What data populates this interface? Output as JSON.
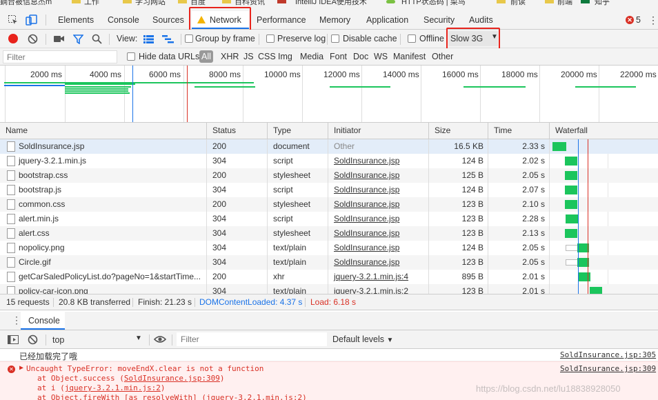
{
  "bookmarks": [
    "鋼台被信息杰m",
    "工作",
    "学习网站",
    "百度",
    "百科资讯",
    "IntelliJ IDEA使用技术",
    "HTTP状态码 | 菜鸟",
    "前读",
    "前端",
    "知乎"
  ],
  "tabs": {
    "items": [
      "Elements",
      "Console",
      "Sources",
      "Network",
      "Performance",
      "Memory",
      "Application",
      "Security",
      "Audits"
    ],
    "active": "Network",
    "error_count": "5"
  },
  "net_toolbar": {
    "view_label": "View:",
    "group_by_frame": "Group by frame",
    "preserve_log": "Preserve log",
    "disable_cache": "Disable cache",
    "offline": "Offline",
    "throttle_value": "Slow 3G"
  },
  "filter": {
    "placeholder": "Filter",
    "hide_data_urls": "Hide data URLs",
    "types": [
      "All",
      "XHR",
      "JS",
      "CSS",
      "Img",
      "Media",
      "Font",
      "Doc",
      "WS",
      "Manifest",
      "Other"
    ]
  },
  "overview": {
    "ticks": [
      "2000 ms",
      "4000 ms",
      "6000 ms",
      "8000 ms",
      "10000 ms",
      "12000 ms",
      "14000 ms",
      "16000 ms",
      "18000 ms",
      "20000 ms",
      "22000 ms"
    ]
  },
  "table": {
    "columns": [
      "Name",
      "Status",
      "Type",
      "Initiator",
      "Size",
      "Time",
      "Waterfall"
    ],
    "rows": [
      {
        "name": "SoldInsurance.jsp",
        "status": "200",
        "type": "document",
        "initiator": "Other",
        "initiator_link": false,
        "size": "16.5 KB",
        "time": "2.33 s"
      },
      {
        "name": "jquery-3.2.1.min.js",
        "status": "304",
        "type": "script",
        "initiator": "SoldInsurance.jsp",
        "initiator_link": true,
        "size": "124 B",
        "time": "2.02 s"
      },
      {
        "name": "bootstrap.css",
        "status": "200",
        "type": "stylesheet",
        "initiator": "SoldInsurance.jsp",
        "initiator_link": true,
        "size": "125 B",
        "time": "2.05 s"
      },
      {
        "name": "bootstrap.js",
        "status": "304",
        "type": "script",
        "initiator": "SoldInsurance.jsp",
        "initiator_link": true,
        "size": "124 B",
        "time": "2.07 s"
      },
      {
        "name": "common.css",
        "status": "200",
        "type": "stylesheet",
        "initiator": "SoldInsurance.jsp",
        "initiator_link": true,
        "size": "123 B",
        "time": "2.10 s"
      },
      {
        "name": "alert.min.js",
        "status": "304",
        "type": "script",
        "initiator": "SoldInsurance.jsp",
        "initiator_link": true,
        "size": "123 B",
        "time": "2.28 s"
      },
      {
        "name": "alert.css",
        "status": "304",
        "type": "stylesheet",
        "initiator": "SoldInsurance.jsp",
        "initiator_link": true,
        "size": "123 B",
        "time": "2.13 s"
      },
      {
        "name": "nopolicy.png",
        "status": "304",
        "type": "text/plain",
        "initiator": "SoldInsurance.jsp",
        "initiator_link": true,
        "size": "124 B",
        "time": "2.05 s"
      },
      {
        "name": "Circle.gif",
        "status": "304",
        "type": "text/plain",
        "initiator": "SoldInsurance.jsp",
        "initiator_link": true,
        "size": "123 B",
        "time": "2.05 s"
      },
      {
        "name": "getCarSaledPolicyList.do?pageNo=1&startTime...",
        "status": "200",
        "type": "xhr",
        "initiator": "jquery-3.2.1.min.js:4",
        "initiator_link": true,
        "size": "895 B",
        "time": "2.01 s"
      },
      {
        "name": "policy-car-icon.png",
        "status": "304",
        "type": "text/plain",
        "initiator": "jquery-3.2.1.min.js:2",
        "initiator_link": true,
        "size": "123 B",
        "time": "2.01 s"
      }
    ]
  },
  "summary": {
    "requests": "15 requests",
    "transferred": "20.8 KB transferred",
    "finish": "Finish: 21.23 s",
    "dom": "DOMContentLoaded: 4.37 s",
    "load": "Load: 6.18 s"
  },
  "console_tab": "Console",
  "console_toolbar": {
    "context": "top",
    "filter_placeholder": "Filter",
    "levels": "Default levels"
  },
  "console_messages": {
    "log_text": "已经加载完了哦",
    "log_source": "SoldInsurance.jsp:305",
    "error_text": "Uncaught TypeError: moveEndX.clear is not a function",
    "error_source": "SoldInsurance.jsp:309",
    "stack": [
      {
        "prefix": "at Object.success (",
        "link": "SoldInsurance.jsp:309",
        "suffix": ")"
      },
      {
        "prefix": "at i (",
        "link": "jquery-3.2.1.min.js:2",
        "suffix": ")"
      },
      {
        "prefix": "at Object.fireWith [as resolveWith] (",
        "link": "jquery-3.2.1.min.js:2",
        "suffix": ")"
      }
    ],
    "watermark": "https://blog.csdn.net/lu18838928050"
  },
  "colors": {
    "highlight_red": "#e8231c",
    "waterfall_green": "#1bc55c",
    "dom_blue": "#1a73e8",
    "load_red": "#d93025",
    "error_red": "#d93025",
    "selected_row": "#e3edf9"
  }
}
